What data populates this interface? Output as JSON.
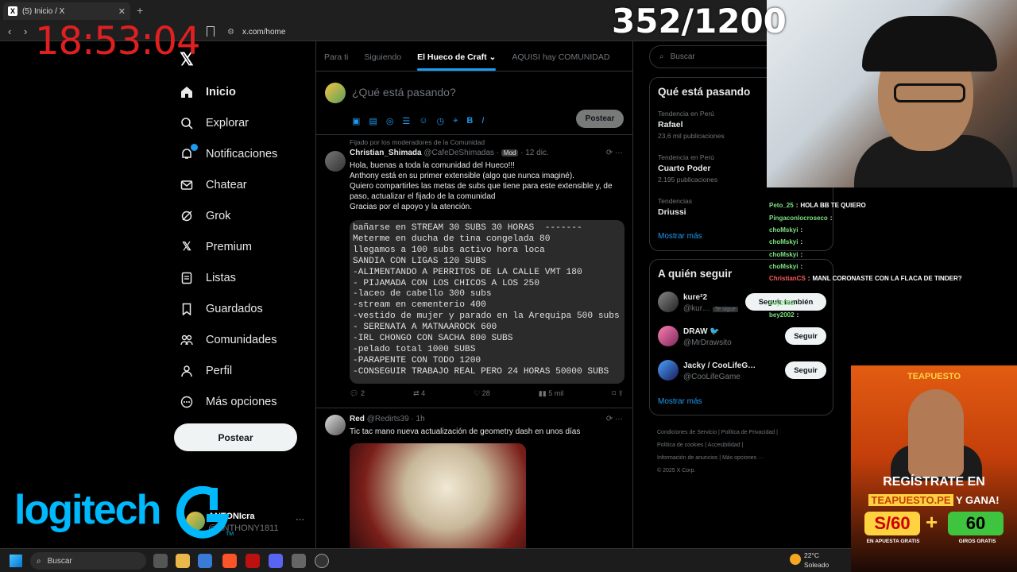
{
  "browser": {
    "tab_title": "(5) Inicio / X",
    "tab_close": "✕",
    "new_tab": "+",
    "url": "x.com/home"
  },
  "overlay": {
    "clock": "18:53:04",
    "counter": "352/1200"
  },
  "nav": {
    "logo": "𝕏",
    "items": [
      {
        "label": "Inicio",
        "icon": "home-icon"
      },
      {
        "label": "Explorar",
        "icon": "search-icon"
      },
      {
        "label": "Notificaciones",
        "icon": "bell-icon"
      },
      {
        "label": "Chatear",
        "icon": "mail-icon"
      },
      {
        "label": "Grok",
        "icon": "grok-icon"
      },
      {
        "label": "Premium",
        "icon": "x-icon"
      },
      {
        "label": "Listas",
        "icon": "list-icon"
      },
      {
        "label": "Guardados",
        "icon": "bookmark-icon"
      },
      {
        "label": "Comunidades",
        "icon": "people-icon"
      },
      {
        "label": "Perfil",
        "icon": "person-icon"
      },
      {
        "label": "Más opciones",
        "icon": "more-icon"
      }
    ],
    "post_button": "Postear"
  },
  "profile": {
    "name": "ANTONIcra",
    "handle": "@ANTHONY1811",
    "more": "···"
  },
  "sponsor": {
    "logo_text": "logitech",
    "tm": "TM"
  },
  "center": {
    "tabs": [
      "Para ti",
      "Siguiendo",
      "El Hueco de Craft",
      "AQUISI hay COMUNIDAD"
    ],
    "composer": {
      "placeholder": "¿Qué está pasando?",
      "post_button": "Postear"
    },
    "tweets": [
      {
        "pinned": "Fijado por los moderadores de la Comunidad",
        "name": "Christian_Shimada",
        "handle": "@CafeDeShimadas",
        "badge": "Mod",
        "date": "12 dic.",
        "text": "Hola, buenas a toda la comunidad del Hueco!!!\nAnthony está en su primer extensible (algo que nunca imaginé).\nQuiero compartirles las metas de subs que tiene para este extensible y, de paso, actualizar el fijado de la comunidad\n Gracias por el apoyo y la atención.",
        "code": "bañarse en STREAM 30 SUBS 30 HORAS  -------\nMeterme en ducha de tina congelada 80\nllegamos a 100 subs activo hora loca\nSANDIA CON LIGAS 120 SUBS\n-ALIMENTANDO A PERRITOS DE LA CALLE VMT 180\n- PIJAMADA CON LOS CHICOS A LOS 250\n-laceo de cabello 300 subs\n-stream en cementerio 400\n-vestido de mujer y parado en la Arequipa 500 subs\n- SERENATA A MATNAAROCK 600\n-IRL CHONGO CON SACHA 800 SUBS\n-pelado total 1000 SUBS\n-PARAPENTE CON TODO 1200\n-CONSEGUIR TRABAJO REAL PERO 24 HORAS 50000 SUBS",
        "replies": "2",
        "reposts": "4",
        "likes": "28",
        "views": "5 mil"
      },
      {
        "name": "Red",
        "handle": "@Redirts39",
        "date": "1h",
        "text": "Tic tac mano nueva actualización de geometry dash en unos días"
      }
    ]
  },
  "right": {
    "search_placeholder": "Buscar",
    "trends_title": "Qué está pasando",
    "trends": [
      {
        "context": "Tendencia en Perú",
        "name": "Rafael",
        "count": "23,6 mil publicaciones"
      },
      {
        "context": "Tendencia en Perú",
        "name": "Cuarto Poder",
        "count": "2.195 publicaciones"
      },
      {
        "context": "Tendencias",
        "name": "Driussi",
        "count": ""
      }
    ],
    "show_more": "Mostrar más",
    "follow_title": "A quién seguir",
    "follow": [
      {
        "name": "kure²2",
        "handle": "@kur…",
        "tag": "Te sigue",
        "button": "Seguir también"
      },
      {
        "name": "DRAW 🐦",
        "handle": "@MrDrawsito",
        "button": "Seguir"
      },
      {
        "name": "Jacky / CooLifeG…",
        "handle": "@CooLifeGame",
        "button": "Seguir"
      }
    ],
    "follow_show_more": "Mostrar más",
    "footer": [
      "Condiciones de Servicio  |  Política de Privacidad  |",
      "Política de cookies  |  Accesibilidad  |",
      "Información de anuncios  |  Más opciones ···",
      "© 2025 X Corp."
    ]
  },
  "chat": [
    {
      "user": "Peto_25",
      "msg": "HOLA BB TE QUIERO",
      "color": "u"
    },
    {
      "user": "Pingaconlocroseco",
      "msg": "",
      "color": "u"
    },
    {
      "user": "choMskyi",
      "msg": "",
      "color": "u"
    },
    {
      "user": "choMskyi",
      "msg": "",
      "color": "u"
    },
    {
      "user": "choMskyi",
      "msg": "",
      "color": "u"
    },
    {
      "user": "choMskyi",
      "msg": "",
      "color": "u"
    },
    {
      "user": "ChristianCS",
      "msg": "MANL CORONASTE CON LA FLACA DE TINDER?",
      "color": "u2"
    },
    {
      "user": "",
      "msg": "",
      "color": "u"
    },
    {
      "user": "bey2002",
      "msg": "",
      "color": "u"
    },
    {
      "user": "bey2002",
      "msg": "",
      "color": "u"
    }
  ],
  "ad": {
    "brand": "TEAPUESTO",
    "line1": "REGÍSTRATE EN",
    "site": "TEAPUESTO.PE",
    "line2_suffix": " Y GANA!",
    "box1": "S/60",
    "plus": "+",
    "box2": "60",
    "cap1": "EN APUESTA GRATIS",
    "cap2": "GIROS GRATIS"
  },
  "taskbar": {
    "search": "Buscar",
    "temp": "22°C",
    "weather": "Soleado"
  },
  "colors": {
    "accent": "#1d9bf0",
    "clock": "#e02020",
    "logitech": "#00b8fc"
  }
}
